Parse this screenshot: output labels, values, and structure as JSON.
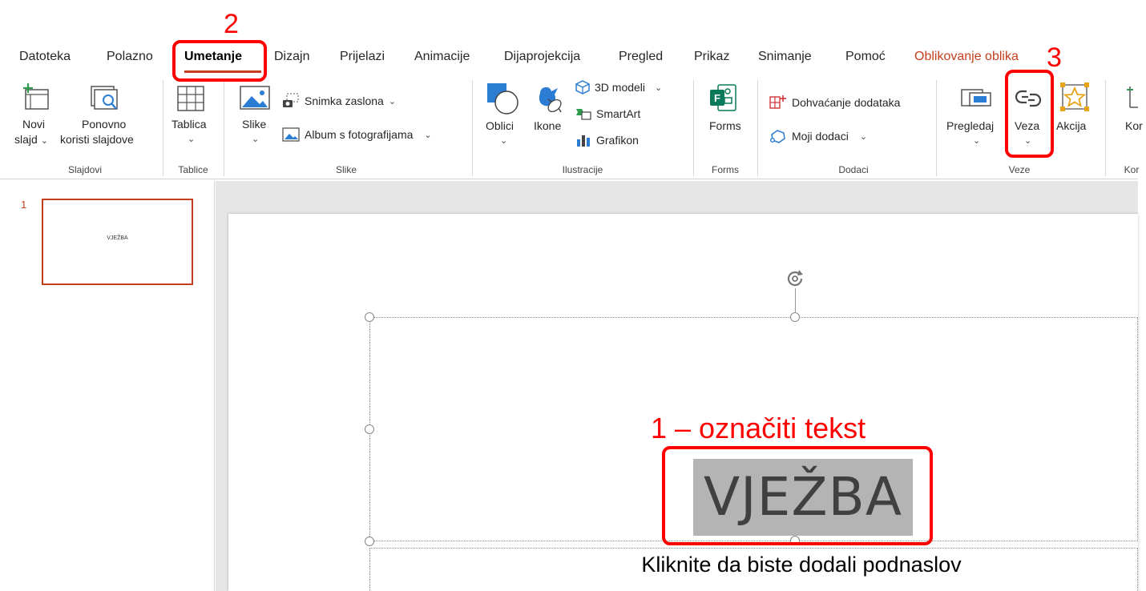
{
  "tabs": [
    {
      "label": "Datoteka"
    },
    {
      "label": "Polazno"
    },
    {
      "label": "Umetanje"
    },
    {
      "label": "Dizajn"
    },
    {
      "label": "Prijelazi"
    },
    {
      "label": "Animacije"
    },
    {
      "label": "Dijaprojekcija"
    },
    {
      "label": "Pregled"
    },
    {
      "label": "Prikaz"
    },
    {
      "label": "Snimanje"
    },
    {
      "label": "Pomoć"
    },
    {
      "label": "Oblikovanje oblika"
    }
  ],
  "active_tab": "Umetanje",
  "ribbon": {
    "novi_line1": "Novi",
    "novi_line2": "slajd",
    "ponovno_line1": "Ponovno",
    "ponovno_line2": "koristi slajdove",
    "tablica": "Tablica",
    "slike": "Slike",
    "snimka_zaslona": "Snimka zaslona",
    "album": "Album s fotografijama",
    "oblici": "Oblici",
    "ikone": "Ikone",
    "modeli3d": "3D modeli",
    "smartart": "SmartArt",
    "grafikon": "Grafikon",
    "forms": "Forms",
    "dohvacanje": "Dohvaćanje dodataka",
    "moji_dodaci": "Moji dodaci",
    "pregledaj": "Pregledaj",
    "veza": "Veza",
    "akcija": "Akcija",
    "ko_cut": "Kor",
    "caret": "⌄",
    "groups": {
      "slajdovi": "Slajdovi",
      "tablice": "Tablice",
      "slike": "Slike",
      "ilustracije": "Ilustracije",
      "forms": "Forms",
      "dodaci": "Dodaci",
      "veze": "Veze",
      "ko_cut": "Kor"
    }
  },
  "thumbnails": [
    {
      "number": "1",
      "title": "VJEŽBA"
    }
  ],
  "slide": {
    "title": "VJEŽBA",
    "subtitle_placeholder": "Kliknite da biste dodali podnaslov"
  },
  "annotations": {
    "step1": "1 – označiti tekst",
    "step2": "2",
    "step3": "3",
    "color": "#ff0000"
  },
  "colors": {
    "accent": "#c43e1c",
    "annotation": "#ff0000",
    "selection": "#b4b4b4"
  }
}
